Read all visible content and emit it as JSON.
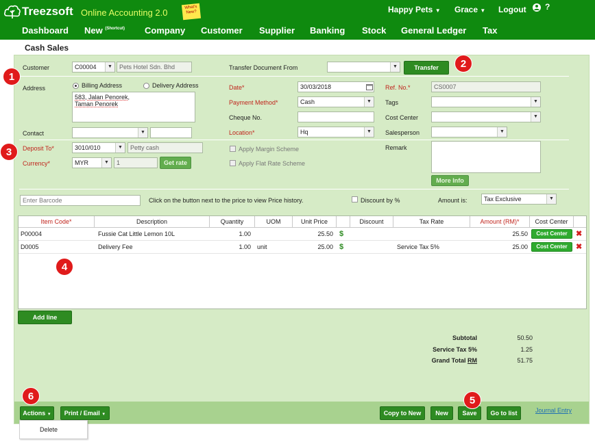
{
  "header": {
    "logo_text": "Treezsoft",
    "app_name": "Online Accounting 2.0",
    "whats_new": "What's New?",
    "company": "Happy Pets",
    "user": "Grace",
    "logout": "Logout",
    "help": "?"
  },
  "nav": {
    "items": [
      "Dashboard",
      "New",
      "Company",
      "Customer",
      "Supplier",
      "Banking",
      "Stock",
      "General Ledger",
      "Tax"
    ],
    "new_shortcut": "(Shortcut)"
  },
  "page_title": "Cash Sales",
  "markers": [
    "1",
    "2",
    "3",
    "4",
    "5",
    "6"
  ],
  "form": {
    "customer_label": "Customer",
    "customer_code": "C00004",
    "customer_name": "Pets Hotel Sdn. Bhd",
    "transfer_label": "Transfer Document From",
    "transfer_value": "",
    "transfer_button": "Transfer",
    "address_label": "Address",
    "billing_address": "Billing Address",
    "delivery_address": "Delivery Address",
    "address_line1": "583, Jalan Penorek,",
    "address_line2": "Taman Penorek",
    "contact_label": "Contact",
    "deposit_label": "Deposit To*",
    "deposit_code": "3010/010",
    "deposit_name": "Petty cash",
    "currency_label": "Currency*",
    "currency_value": "MYR",
    "rate_value": "1",
    "get_rate": "Get rate",
    "date_label": "Date*",
    "date_value": "30/03/2018",
    "payment_label": "Payment Method*",
    "payment_value": "Cash",
    "cheque_label": "Cheque No.",
    "location_label": "Location*",
    "location_value": "Hq",
    "margin_scheme": "Apply Margin Scheme",
    "flat_rate": "Apply Flat Rate Scheme",
    "ref_label": "Ref. No.*",
    "ref_value": "CS0007",
    "tags_label": "Tags",
    "cost_center_label": "Cost Center",
    "salesperson_label": "Salesperson",
    "remark_label": "Remark",
    "more_info": "More Info"
  },
  "barcode": {
    "placeholder": "Enter Barcode",
    "hint": "Click on the button next to the price to view Price history.",
    "discount_by": "Discount by %",
    "amount_is_label": "Amount is:",
    "amount_is_value": "Tax Exclusive"
  },
  "grid": {
    "headers": [
      "Item Code*",
      "Description",
      "Quantity",
      "UOM",
      "Unit Price",
      "",
      "Discount",
      "Tax Rate",
      "Amount (RM)*",
      "Cost Center",
      ""
    ],
    "rows": [
      {
        "code": "P00004",
        "description": "Fussie Cat Little Lemon 10L",
        "quantity": "1.00",
        "uom": "",
        "unit_price": "25.50",
        "discount": "",
        "tax_rate": "",
        "amount": "25.50",
        "cost_center": "Cost Center"
      },
      {
        "code": "D0005",
        "description": "Delivery Fee",
        "quantity": "1.00",
        "uom": "unit",
        "unit_price": "25.00",
        "discount": "",
        "tax_rate": "Service Tax 5%",
        "amount": "25.00",
        "cost_center": "Cost Center"
      }
    ],
    "add_line": "Add line"
  },
  "totals": {
    "subtotal_label": "Subtotal",
    "subtotal_value": "50.50",
    "tax_label": "Service Tax 5%",
    "tax_value": "1.25",
    "grand_label": "Grand Total",
    "grand_currency": "RM",
    "grand_value": "51.75"
  },
  "footer": {
    "actions": "Actions",
    "print_email": "Print / Email",
    "copy_to_new": "Copy to New",
    "new": "New",
    "save": "Save",
    "go_to_list": "Go to list",
    "journal_entry": "Journal Entry",
    "delete": "Delete"
  },
  "colors": {
    "brand_green": "#0f8a0f",
    "panel_bg": "#d6ebc6",
    "button_green": "#2e8b22",
    "marker_red": "#e01b1b",
    "required_red": "#c0241c"
  }
}
